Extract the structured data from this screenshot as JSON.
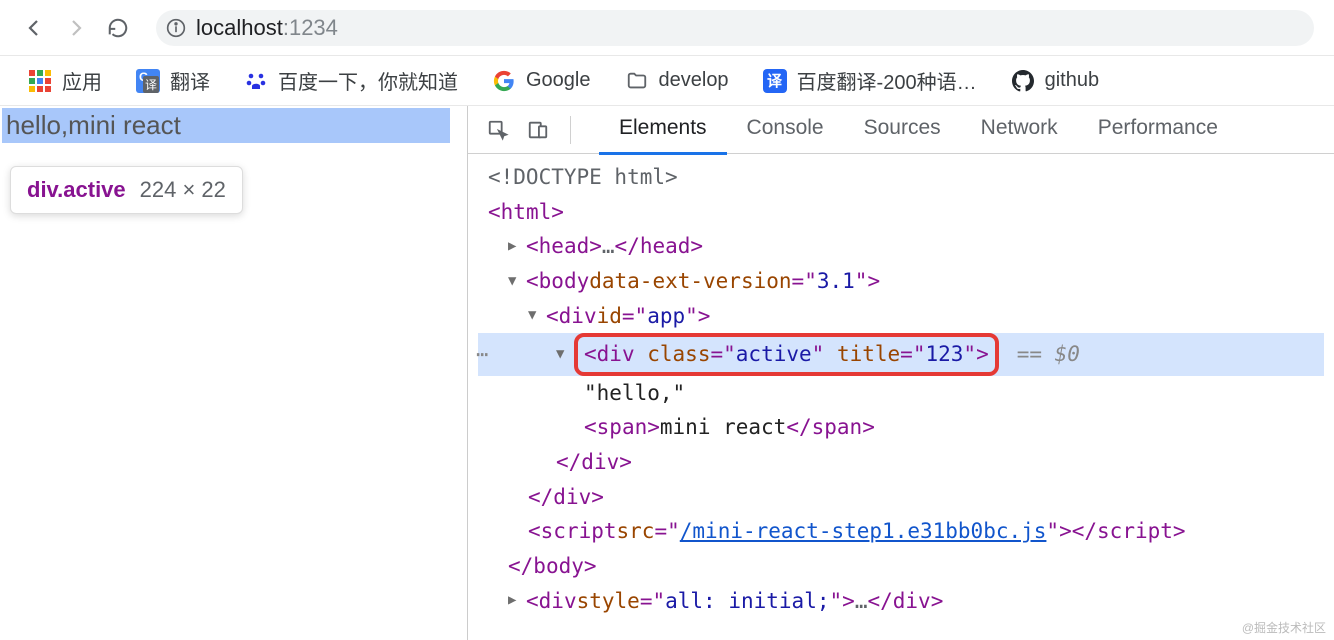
{
  "url": {
    "host": "localhost",
    "port": ":1234"
  },
  "bookmarks": [
    {
      "key": "apps",
      "label": "应用"
    },
    {
      "key": "translate",
      "label": "翻译"
    },
    {
      "key": "baidu",
      "label": "百度一下，你就知道"
    },
    {
      "key": "google",
      "label": "Google"
    },
    {
      "key": "develop",
      "label": "develop"
    },
    {
      "key": "baidufanyi",
      "label": "百度翻译-200种语…"
    },
    {
      "key": "github",
      "label": "github"
    }
  ],
  "page": {
    "highlighted_text": "hello,mini react",
    "tooltip_tag": "div",
    "tooltip_class": ".active",
    "tooltip_dims": "224 × 22"
  },
  "devtools": {
    "tabs": [
      "Elements",
      "Console",
      "Sources",
      "Network",
      "Performance"
    ],
    "active_tab": "Elements"
  },
  "dom": {
    "doctype": "<!DOCTYPE html>",
    "html_open": "html",
    "head": {
      "open": "head",
      "ellipsis": "…",
      "close": "/head"
    },
    "body": {
      "tag": "body",
      "attr_name": "data-ext-version",
      "attr_val": "3.1"
    },
    "app": {
      "tag": "div",
      "attr_name": "id",
      "attr_val": "app"
    },
    "active": {
      "tag": "div",
      "class_name": "class",
      "class_val": "active",
      "title_name": "title",
      "title_val": "123",
      "eq0": "== $0"
    },
    "text_hello": "\"hello,\"",
    "span": {
      "open": "span",
      "text": "mini react",
      "close": "/span"
    },
    "close_div1": "/div",
    "close_div2": "/div",
    "script": {
      "tag": "script",
      "attr": "src",
      "val": "/mini-react-step1.e31bb0bc.js",
      "close": "/script"
    },
    "close_body": "/body",
    "style_div": {
      "tag": "div",
      "attr": "style",
      "val": "all: initial;",
      "ellipsis": "…",
      "close": "/div"
    }
  },
  "watermark": "@掘金技术社区"
}
